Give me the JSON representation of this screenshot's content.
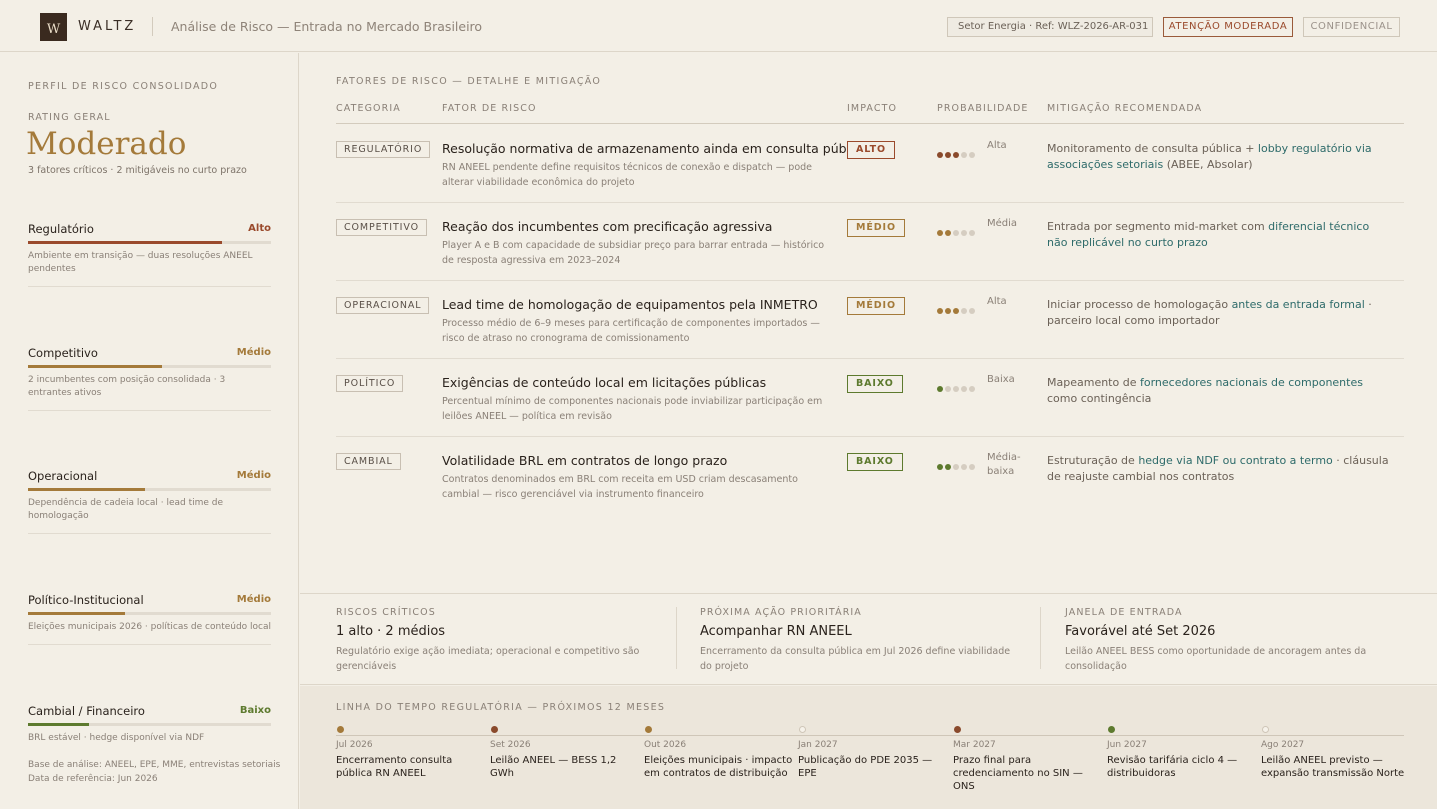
{
  "header": {
    "brand": "WALTZ",
    "logo_letter": "W",
    "title": "Análise de Risco — Entrada no Mercado Brasileiro",
    "sector_ref": "Setor Energia · Ref: WLZ-2026-AR-031",
    "alert": "ATENÇÃO MODERADA",
    "confidential": "CONFIDENCIAL"
  },
  "sidebar": {
    "title": "PERFIL DE RISCO CONSOLIDADO",
    "rating_label": "RATING GERAL",
    "rating": "Moderado",
    "rating_sub": "3 fatores críticos · 2 mitigáveis no curto prazo",
    "categories": [
      {
        "name": "Regulatório",
        "level": "Alto",
        "level_color": "#9a4a2c",
        "fill": 0.8,
        "desc": "Ambiente em transição — duas resoluções ANEEL pendentes"
      },
      {
        "name": "Competitivo",
        "level": "Médio",
        "level_color": "#a47a3a",
        "fill": 0.55,
        "desc": "2 incumbentes com posição consolidada · 3 entrantes ativos"
      },
      {
        "name": "Operacional",
        "level": "Médio",
        "level_color": "#a47a3a",
        "fill": 0.48,
        "desc": "Dependência de cadeia local · lead time de homologação"
      },
      {
        "name": "Político-Institucional",
        "level": "Médio",
        "level_color": "#a47a3a",
        "fill": 0.4,
        "desc": "Eleições municipais 2026 · políticas de conteúdo local"
      },
      {
        "name": "Cambial / Financeiro",
        "level": "Baixo",
        "level_color": "#5d7a2e",
        "fill": 0.25,
        "desc": "BRL estável · hedge disponível via NDF"
      }
    ],
    "footer_line1": "Base de análise: ANEEL, EPE, MME, entrevistas setoriais",
    "footer_line2": "Data de referência: Jun 2026"
  },
  "main": {
    "title": "FATORES DE RISCO — DETALHE E MITIGAÇÃO",
    "columns": {
      "category": "CATEGORIA",
      "factor": "FATOR DE RISCO",
      "impact": "IMPACTO",
      "probability": "PROBABILIDADE",
      "mitigation": "MITIGAÇÃO RECOMENDADA"
    },
    "rows": [
      {
        "category": "REGULATÓRIO",
        "title": "Resolução normativa de armazenamento ainda em consulta pública",
        "desc": "RN ANEEL pendente define requisitos técnicos de conexão e dispatch — pode alterar viabilidade econômica do projeto",
        "impact": "ALTO",
        "impact_color": "#9a4a2c",
        "prob_level": 3,
        "prob_color": "#8a4a2c",
        "prob_label": "Alta",
        "mit_pre": "Monitoramento de consulta pública + ",
        "mit_hl": "lobby regulatório via associações setoriais",
        "mit_post": " (ABEE, Absolar)"
      },
      {
        "category": "COMPETITIVO",
        "title": "Reação dos incumbentes com precificação agressiva",
        "desc": "Player A e B com capacidade de subsidiar preço para barrar entrada — histórico de resposta agressiva em 2023–2024",
        "impact": "MÉDIO",
        "impact_color": "#a47a3a",
        "prob_level": 2,
        "prob_color": "#a47a3a",
        "prob_label": "Média",
        "mit_pre": "Entrada por segmento mid-market com ",
        "mit_hl": "diferencial técnico não replicável no curto prazo",
        "mit_post": ""
      },
      {
        "category": "OPERACIONAL",
        "title": "Lead time de homologação de equipamentos pela INMETRO",
        "desc": "Processo médio de 6–9 meses para certificação de componentes importados — risco de atraso no cronograma de comissionamento",
        "impact": "MÉDIO",
        "impact_color": "#a47a3a",
        "prob_level": 3,
        "prob_color": "#a47a3a",
        "prob_label": "Alta",
        "mit_pre": "Iniciar processo de homologação ",
        "mit_hl": "antes da entrada formal",
        "mit_post": " · parceiro local como importador"
      },
      {
        "category": "POLÍTICO",
        "title": "Exigências de conteúdo local em licitações públicas",
        "desc": "Percentual mínimo de componentes nacionais pode inviabilizar participação em leilões ANEEL — política em revisão",
        "impact": "BAIXO",
        "impact_color": "#5d7a2e",
        "prob_level": 1,
        "prob_color": "#5d7a2e",
        "prob_label": "Baixa",
        "mit_pre": "Mapeamento de ",
        "mit_hl": "fornecedores nacionais de componentes",
        "mit_post": " como contingência"
      },
      {
        "category": "CAMBIAL",
        "title": "Volatilidade BRL em contratos de longo prazo",
        "desc": "Contratos denominados em BRL com receita em USD criam descasamento cambial — risco gerenciável via instrumento financeiro",
        "impact": "BAIXO",
        "impact_color": "#5d7a2e",
        "prob_level": 2,
        "prob_color": "#5d7a2e",
        "prob_label": "Média-baixa",
        "mit_pre": "Estruturação de ",
        "mit_hl": "hedge via NDF ou contrato a termo",
        "mit_post": " · cláusula de reajuste cambial nos contratos"
      }
    ]
  },
  "summary": [
    {
      "label": "RISCOS CRÍTICOS",
      "value": "1 alto · 2 médios",
      "desc": "Regulatório exige ação imediata; operacional e competitivo são gerenciáveis"
    },
    {
      "label": "PRÓXIMA AÇÃO PRIORITÁRIA",
      "value": "Acompanhar RN ANEEL",
      "desc": "Encerramento da consulta pública em Jul 2026 define viabilidade do projeto"
    },
    {
      "label": "JANELA DE ENTRADA",
      "value": "Favorável até Set 2026",
      "desc": "Leilão ANEEL BESS como oportunidade de ancoragem antes da consolidação"
    }
  ],
  "timeline": {
    "title": "LINHA DO TEMPO REGULATÓRIA — PRÓXIMOS 12 MESES",
    "events": [
      {
        "date": "Jul 2026",
        "text": "Encerramento consulta pública RN ANEEL",
        "color": "#a47a3a",
        "filled": true
      },
      {
        "date": "Set 2026",
        "text": "Leilão ANEEL — BESS 1,2 GWh",
        "color": "#8a4a2c",
        "filled": true
      },
      {
        "date": "Out 2026",
        "text": "Eleições municipais · impacto em contratos de distribuição",
        "color": "#a47a3a",
        "filled": true
      },
      {
        "date": "Jan 2027",
        "text": "Publicação do PDE 2035 — EPE",
        "color": "#cfc6b8",
        "filled": false
      },
      {
        "date": "Mar 2027",
        "text": "Prazo final para credenciamento no SIN — ONS",
        "color": "#8a4a2c",
        "filled": true
      },
      {
        "date": "Jun 2027",
        "text": "Revisão tarifária ciclo 4 — distribuidoras",
        "color": "#5d7a2e",
        "filled": true
      },
      {
        "date": "Ago 2027",
        "text": "Leilão ANEEL previsto — expansão transmissão Norte",
        "color": "#cfc6b8",
        "filled": false
      }
    ]
  }
}
